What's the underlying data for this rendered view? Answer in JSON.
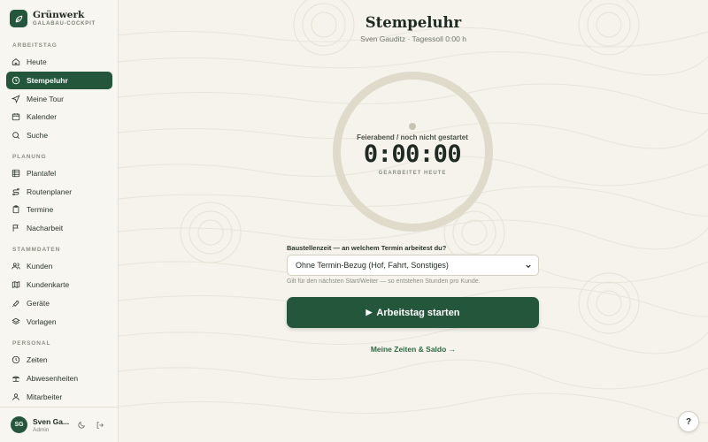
{
  "brand": {
    "name": "Grünwerk",
    "subtitle": "GALABAU-COCKPIT"
  },
  "sidebar": {
    "sections": [
      {
        "label": "ARBEITSTAG",
        "items": [
          {
            "label": "Heute",
            "icon": "home-icon"
          },
          {
            "label": "Stempeluhr",
            "icon": "clock-icon",
            "active": true
          },
          {
            "label": "Meine Tour",
            "icon": "navigation-icon"
          },
          {
            "label": "Kalender",
            "icon": "calendar-icon"
          },
          {
            "label": "Suche",
            "icon": "search-icon"
          }
        ]
      },
      {
        "label": "PLANUNG",
        "items": [
          {
            "label": "Plantafel",
            "icon": "grid-icon"
          },
          {
            "label": "Routenplaner",
            "icon": "route-icon"
          },
          {
            "label": "Termine",
            "icon": "clipboard-icon"
          },
          {
            "label": "Nacharbeit",
            "icon": "flag-icon"
          }
        ]
      },
      {
        "label": "STAMMDATEN",
        "items": [
          {
            "label": "Kunden",
            "icon": "users-icon"
          },
          {
            "label": "Kundenkarte",
            "icon": "map-icon"
          },
          {
            "label": "Geräte",
            "icon": "tool-icon"
          },
          {
            "label": "Vorlagen",
            "icon": "layers-icon"
          }
        ]
      },
      {
        "label": "PERSONAL",
        "items": [
          {
            "label": "Zeiten",
            "icon": "clock-icon"
          },
          {
            "label": "Abwesenheiten",
            "icon": "beach-icon"
          },
          {
            "label": "Mitarbeiter",
            "icon": "user-icon"
          }
        ]
      }
    ]
  },
  "user": {
    "initials": "SG",
    "name": "Sven Ga...",
    "role": "Admin"
  },
  "page": {
    "title": "Stempeluhr",
    "subtitle": "Sven Gauditz · Tagessoll 0:00 h"
  },
  "clock": {
    "status": "Feierabend / noch nicht gestartet",
    "time": "0:00:00",
    "caption": "GEARBEITET HEUTE"
  },
  "assignment": {
    "label": "Baustellenzeit — an welchem Termin arbeitest du?",
    "selected": "Ohne Termin-Bezug (Hof, Fahrt, Sonstiges)",
    "hint": "Gilt für den nächsten Start/Weiter — so entstehen Stunden pro Kunde."
  },
  "actions": {
    "start_label": "Arbeitstag starten",
    "times_link": "Meine Zeiten & Saldo →"
  },
  "help": {
    "label": "?"
  },
  "colors": {
    "accent": "#23563a",
    "background": "#f5f3ec",
    "sidebar": "#f8f6f0",
    "ring": "#dfdac9"
  }
}
